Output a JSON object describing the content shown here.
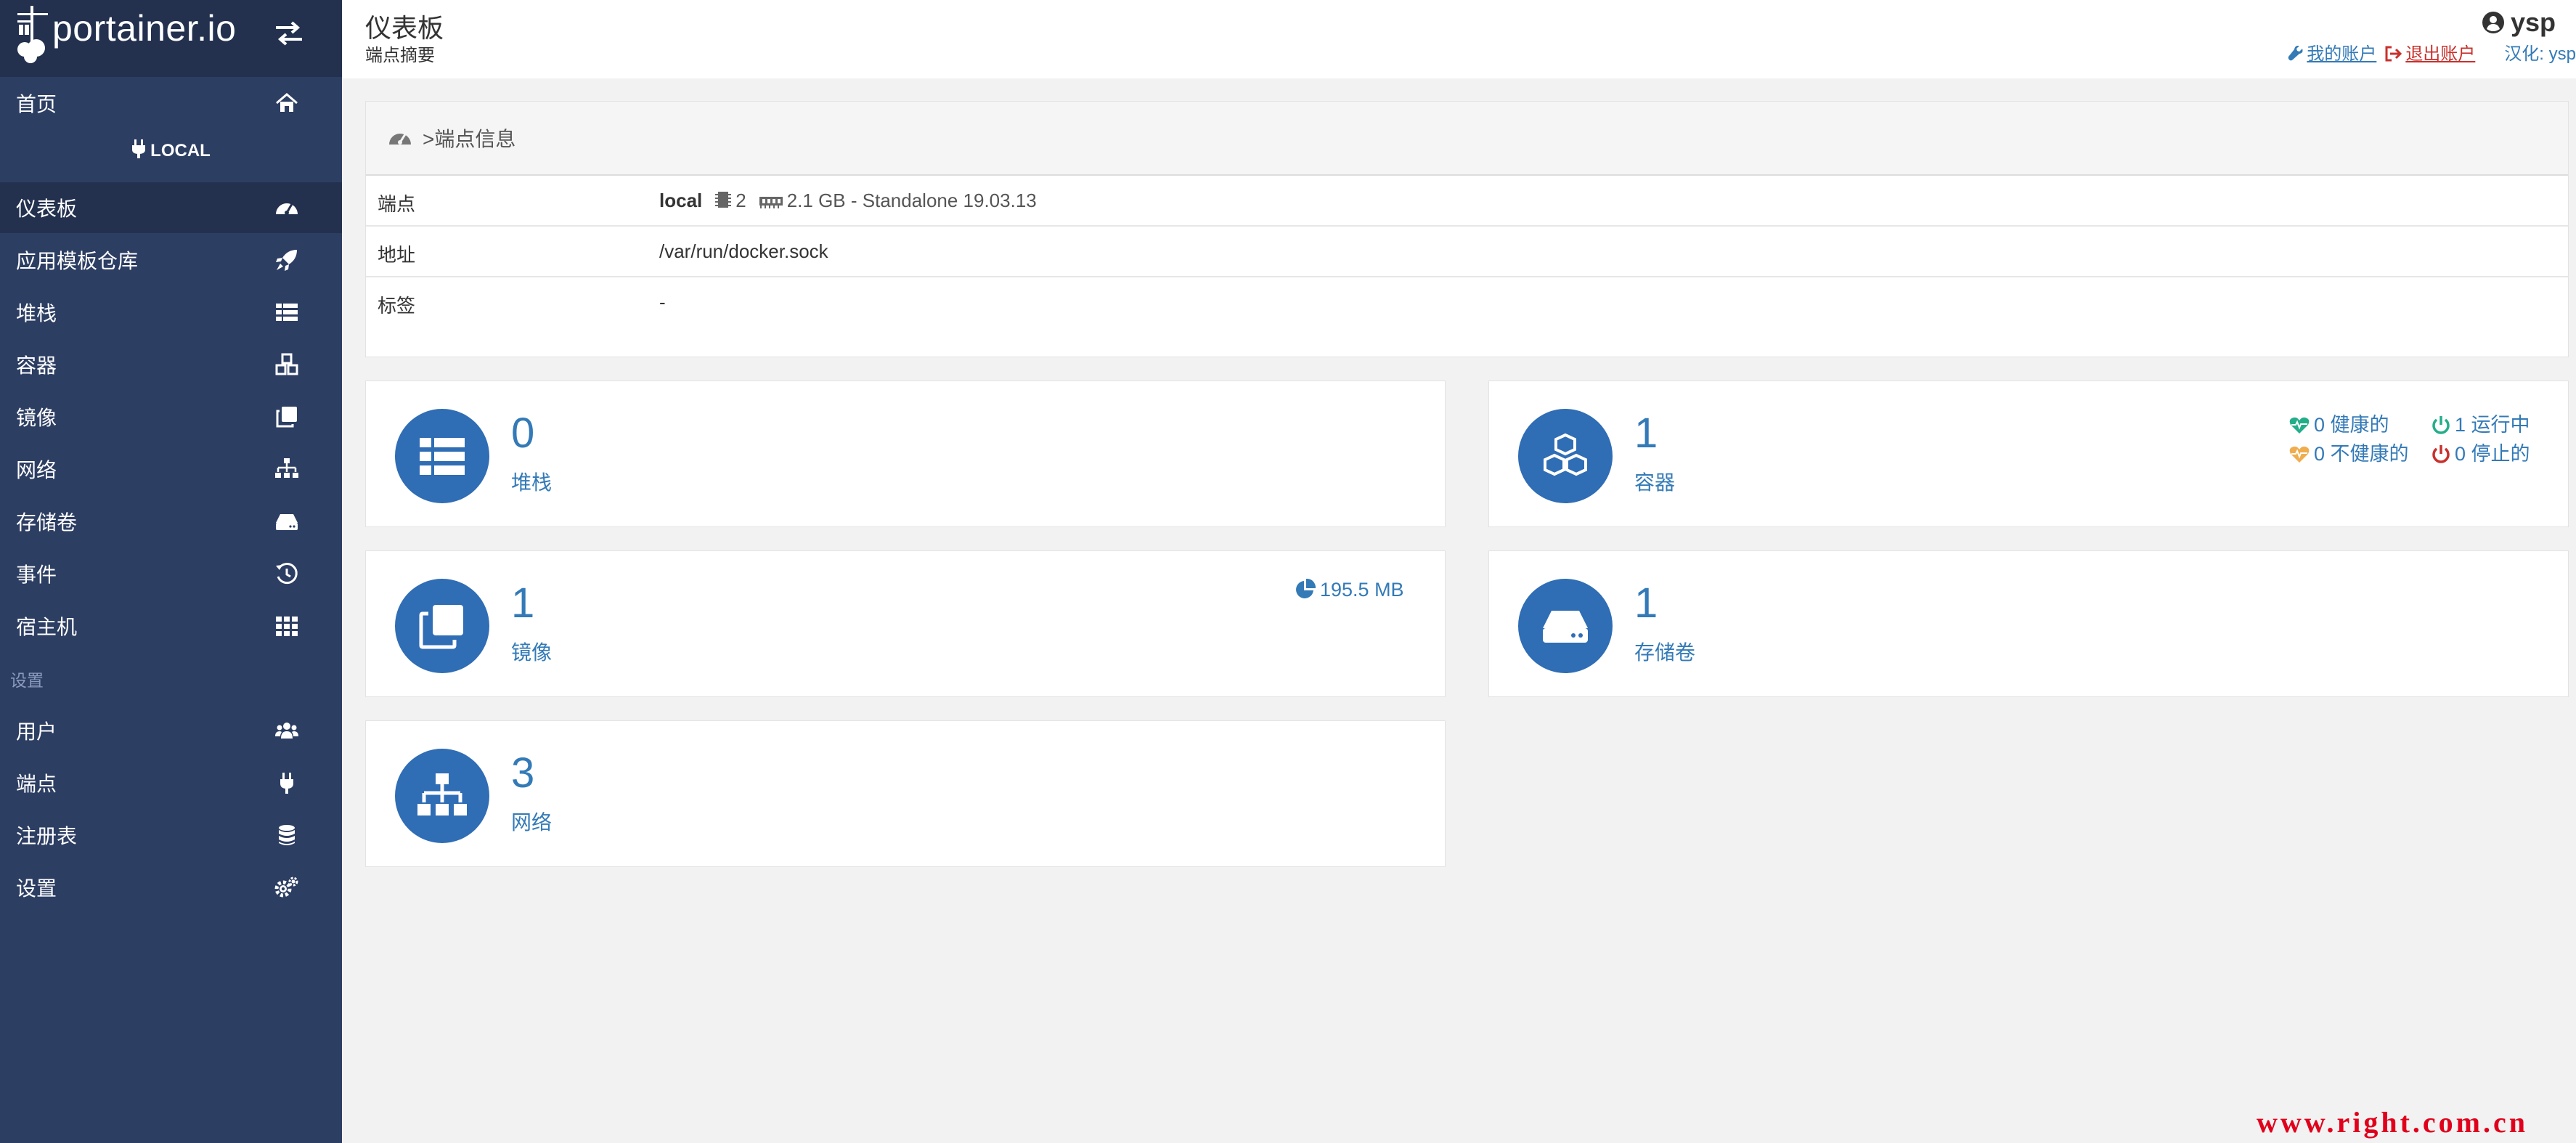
{
  "sidebar": {
    "brand": "portainer.io",
    "endpoint_heading": "LOCAL",
    "items": [
      {
        "label": "首页"
      },
      {
        "label": "仪表板"
      },
      {
        "label": "应用模板仓库"
      },
      {
        "label": "堆栈"
      },
      {
        "label": "容器"
      },
      {
        "label": "镜像"
      },
      {
        "label": "网络"
      },
      {
        "label": "存储卷"
      },
      {
        "label": "事件"
      },
      {
        "label": "宿主机"
      }
    ],
    "settings_title": "设置",
    "settings_items": [
      {
        "label": "用户"
      },
      {
        "label": "端点"
      },
      {
        "label": "注册表"
      },
      {
        "label": "设置"
      }
    ]
  },
  "header": {
    "title": "仪表板",
    "subtitle": "端点摘要",
    "username": "ysp",
    "my_account": "我的账户",
    "logout": "退出账户",
    "credit": "汉化: ysp"
  },
  "endpoint_info": {
    "title": ">端点信息",
    "rows": [
      {
        "key": "端点",
        "name": "local",
        "cpu": "2",
        "memory": "2.1 GB - Standalone 19.03.13"
      },
      {
        "key": "地址",
        "value": "/var/run/docker.sock"
      },
      {
        "key": "标签",
        "value": "-"
      }
    ]
  },
  "cards": {
    "stacks": {
      "count": "0",
      "label": "堆栈"
    },
    "containers": {
      "count": "1",
      "label": "容器",
      "healthy": "0 健康的",
      "running": "1 运行中",
      "unhealthy": "0 不健康的",
      "stopped": "0 停止的"
    },
    "images": {
      "count": "1",
      "label": "镜像",
      "size": "195.5 MB"
    },
    "volumes": {
      "count": "1",
      "label": "存储卷"
    },
    "networks": {
      "count": "3",
      "label": "网络"
    }
  },
  "watermark": "www.right.com.cn",
  "colors": {
    "sidebar": "#2d3e63",
    "sidebar_dark": "#23314f",
    "accent": "#337ab7",
    "card_icon": "#2f6db5",
    "healthy": "#23ae89",
    "unhealthy": "#f0ad4e",
    "stopped": "#c9302c"
  }
}
